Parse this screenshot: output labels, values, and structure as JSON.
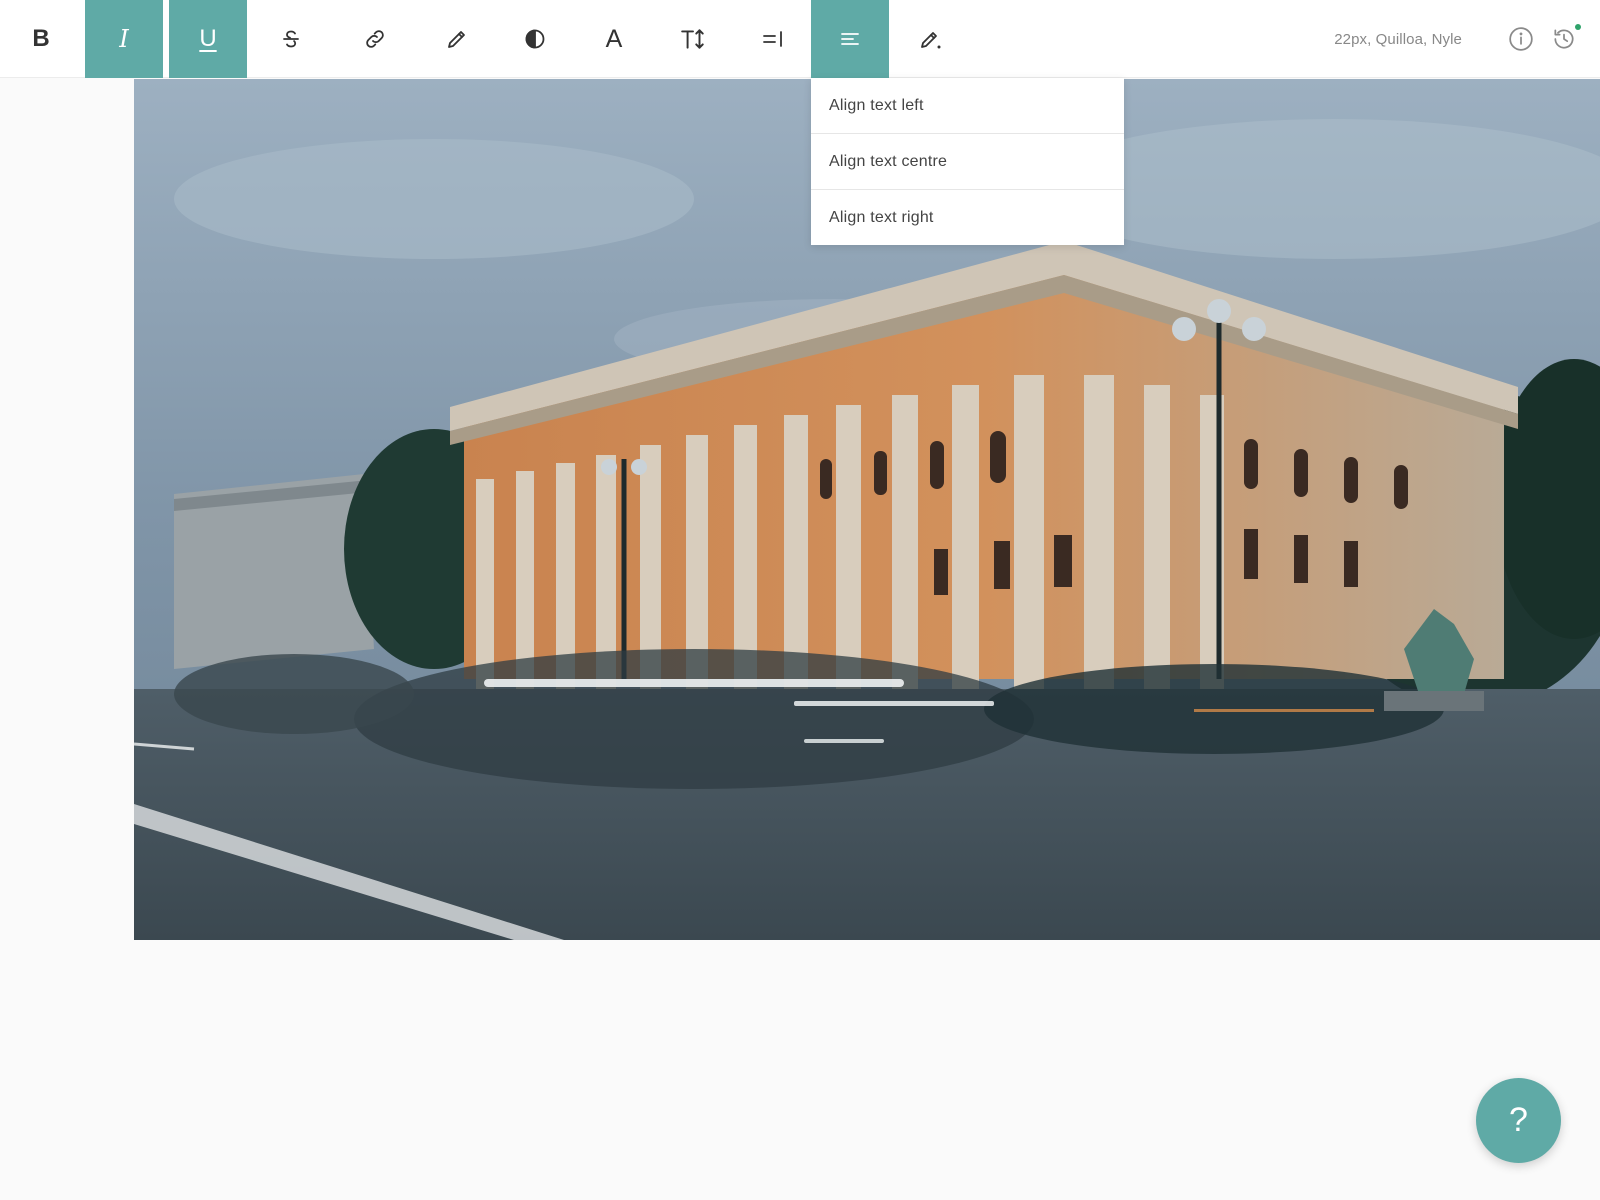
{
  "toolbar": {
    "bold_glyph": "B",
    "italic_glyph": "I",
    "underline_glyph": "U",
    "font_color_glyph": "A",
    "font_info": "22px, Quilloa, Nyle",
    "active_items": [
      "italic",
      "underline",
      "text-align"
    ],
    "icons": [
      "bold-icon",
      "italic-icon",
      "underline-icon",
      "strikethrough-icon",
      "link-icon",
      "pencil-icon",
      "contrast-icon",
      "font-color-icon",
      "font-size-icon",
      "indent-icon",
      "align-left-icon",
      "highlight-pen-icon",
      "info-icon",
      "history-icon"
    ]
  },
  "align_menu": {
    "items": [
      {
        "label": "Align text left"
      },
      {
        "label": "Align text centre"
      },
      {
        "label": "Align text right"
      }
    ]
  },
  "help_button": {
    "label": "?"
  },
  "colors": {
    "accent": "#5faaa6",
    "toolbar_bg": "#ffffff",
    "page_bg": "#fafafa",
    "status_dot": "#2fa36b"
  }
}
